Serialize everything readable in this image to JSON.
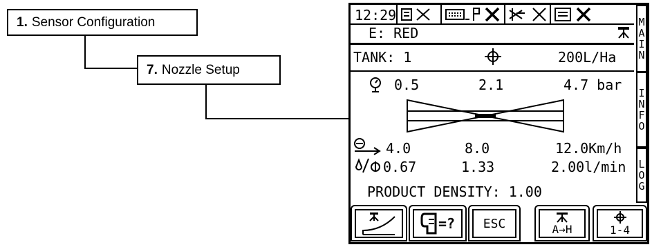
{
  "callouts": [
    {
      "number": "1.",
      "text": "Sensor Configuration"
    },
    {
      "number": "7.",
      "text": "Nozzle Setup"
    }
  ],
  "status_bar": {
    "time": "12:29",
    "icons": [
      "document-x-icon",
      "keyboard-flag-x-icon",
      "satellite-x-icon",
      "memory-x-icon"
    ]
  },
  "header": {
    "section": "E: RED",
    "section_icon": "nozzle-icon"
  },
  "tank_row": {
    "tank": "TANK: 1",
    "target_icon": "crosshair-icon",
    "rate": "200L/Ha"
  },
  "pressure_row": {
    "icon": "pressure-gauge-icon",
    "min": "0.5",
    "mid": "2.1",
    "max": "4.7 bar"
  },
  "speed_row": {
    "icon": "speed-icon",
    "min": "4.0",
    "mid": "8.0",
    "max": "12.0Km/h"
  },
  "flow_row": {
    "icon": "flow-icon",
    "min": "0.67",
    "mid": "1.33",
    "max": "2.00l/min"
  },
  "density": "PRODUCT DENSITY: 1.00",
  "side_tabs": [
    {
      "label": "MAIN",
      "letters": [
        "M",
        "A",
        "I",
        "N"
      ]
    },
    {
      "label": "INFO",
      "letters": [
        "I",
        "N",
        "F",
        "O"
      ]
    },
    {
      "label": "LOG",
      "letters": [
        "L",
        "O",
        "G"
      ]
    }
  ],
  "softkeys": [
    {
      "icon": "boom-curve-icon",
      "label": ""
    },
    {
      "icon": "help-tank-icon",
      "label": "=?"
    },
    {
      "icon": "",
      "label": "ESC"
    },
    {
      "icon": "nozzle-icon",
      "label": "A→H"
    },
    {
      "icon": "crosshair-icon",
      "label": "1-4"
    }
  ]
}
